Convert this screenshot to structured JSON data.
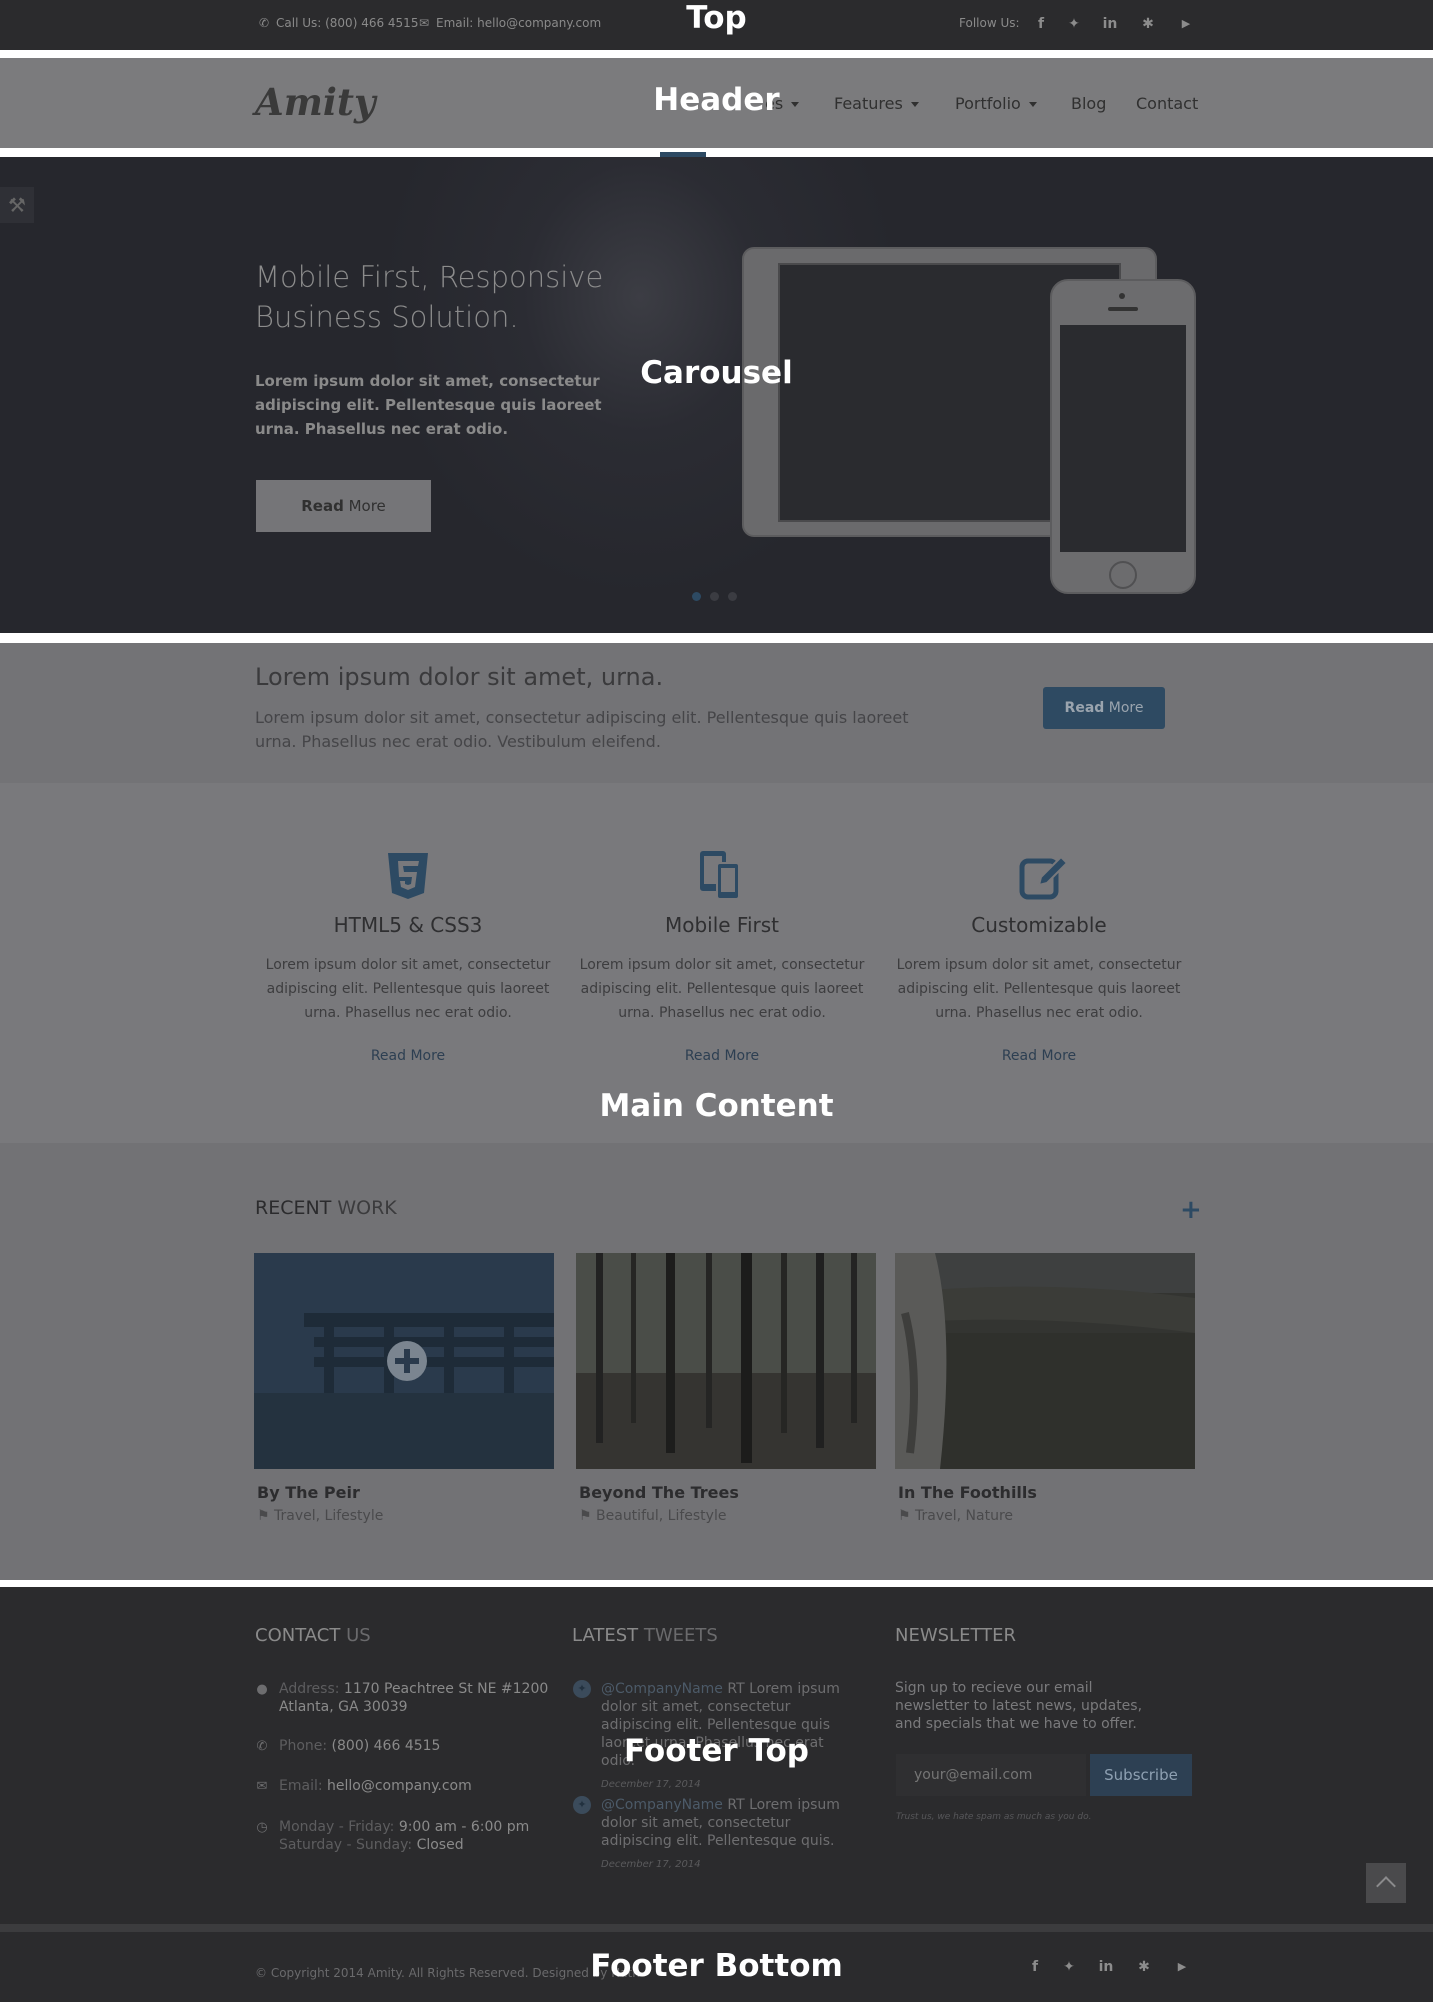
{
  "section_tags": {
    "top": "Top",
    "header": "Header",
    "carousel": "Carousel",
    "main": "Main Content",
    "footer_top": "Footer Top",
    "footer_bottom": "Footer Bottom"
  },
  "topbar": {
    "phone": "Call Us: (800) 466 4515",
    "email": "Email: hello@company.com",
    "follow": "Follow Us:",
    "social_icons": [
      "facebook-icon",
      "twitter-icon",
      "linkedin-icon",
      "yelp-icon",
      "youtube-icon"
    ]
  },
  "header": {
    "logo": "Amity",
    "nav": [
      {
        "label": "es",
        "dropdown": true
      },
      {
        "label": "Features",
        "dropdown": true
      },
      {
        "label": "Portfolio",
        "dropdown": true
      },
      {
        "label": "Blog",
        "dropdown": false
      },
      {
        "label": "Contact",
        "dropdown": false
      }
    ]
  },
  "carousel": {
    "title_line1": "Mobile First, Responsive",
    "title_line2": "Business Solution.",
    "text": "Lorem ipsum dolor sit amet, consectetur adipiscing elit. Pellentesque quis laoreet urna. Phasellus nec erat odio.",
    "button_bold": "Read",
    "button_rest": " More",
    "slides": 3,
    "active_slide": 1
  },
  "banner": {
    "title": "Lorem ipsum dolor sit amet, urna.",
    "text": "Lorem ipsum dolor sit amet, consectetur adipiscing elit. Pellentesque quis laoreet urna. Phasellus nec erat odio. Vestibulum eleifend.",
    "button_bold": "Read",
    "button_rest": " More"
  },
  "features": [
    {
      "icon": "html5-icon",
      "title": "HTML5 & CSS3",
      "text": "Lorem ipsum dolor sit amet, consectetur adipiscing elit. Pellentesque quis laoreet urna. Phasellus nec erat odio.",
      "link": "Read More"
    },
    {
      "icon": "mobile-devices-icon",
      "title": "Mobile First",
      "text": "Lorem ipsum dolor sit amet, consectetur adipiscing elit. Pellentesque quis laoreet urna. Phasellus nec erat odio.",
      "link": "Read More"
    },
    {
      "icon": "edit-icon",
      "title": "Customizable",
      "text": "Lorem ipsum dolor sit amet, consectetur adipiscing elit. Pellentesque quis laoreet urna. Phasellus nec erat odio.",
      "link": "Read More"
    }
  ],
  "recent_work": {
    "title_bold": "RECENT",
    "title_rest": " WORK",
    "items": [
      {
        "name": "By The Peir",
        "tags": "Travel, Lifestyle"
      },
      {
        "name": "Beyond The Trees",
        "tags": "Beautiful, Lifestyle"
      },
      {
        "name": "In The Foothills",
        "tags": "Travel, Nature"
      }
    ]
  },
  "footer": {
    "contact_head_a": "CONTACT",
    "contact_head_b": " US",
    "address_label": "Address: ",
    "address_line1": "1170 Peachtree St NE #1200",
    "address_line2": "Atlanta, GA 30039",
    "phone_label": "Phone: ",
    "phone": "(800) 466 4515",
    "email_label": "Email: ",
    "email": "hello@company.com",
    "hours_label1": "Monday - Friday: ",
    "hours1": "9:00 am - 6:00 pm",
    "hours_label2": "Saturday - Sunday: ",
    "hours2": "Closed",
    "tweets_head_a": "LATEST",
    "tweets_head_b": " TWEETS",
    "tweets": [
      {
        "handle": "@CompanyName",
        "text": " RT Lorem ipsum dolor sit amet, consectetur adipiscing elit. Pellentesque quis laoreet urna. Phasellus nec erat odio.",
        "date": "December 17, 2014"
      },
      {
        "handle": "@CompanyName",
        "text": " RT Lorem ipsum dolor sit amet, consectetur adipiscing elit. Pellentesque quis.",
        "date": "December 17, 2014"
      }
    ],
    "newsletter_head": "NEWSLETTER",
    "newsletter_text": "Sign up to recieve our email newsletter to latest news, updates, and specials that we have to offer.",
    "newsletter_placeholder": "your@email.com",
    "subscribe": "Subscribe",
    "newsletter_note": "Trust us, we hate spam as much as you do."
  },
  "footer_bottom": {
    "copyright": "© Copyright 2014 Amity. All Rights Reserved. Designed by Nath"
  },
  "colors": {
    "accent": "#2d4a63",
    "dark_bg": "#2b2b2d",
    "overlay_gray": "#79797c"
  }
}
